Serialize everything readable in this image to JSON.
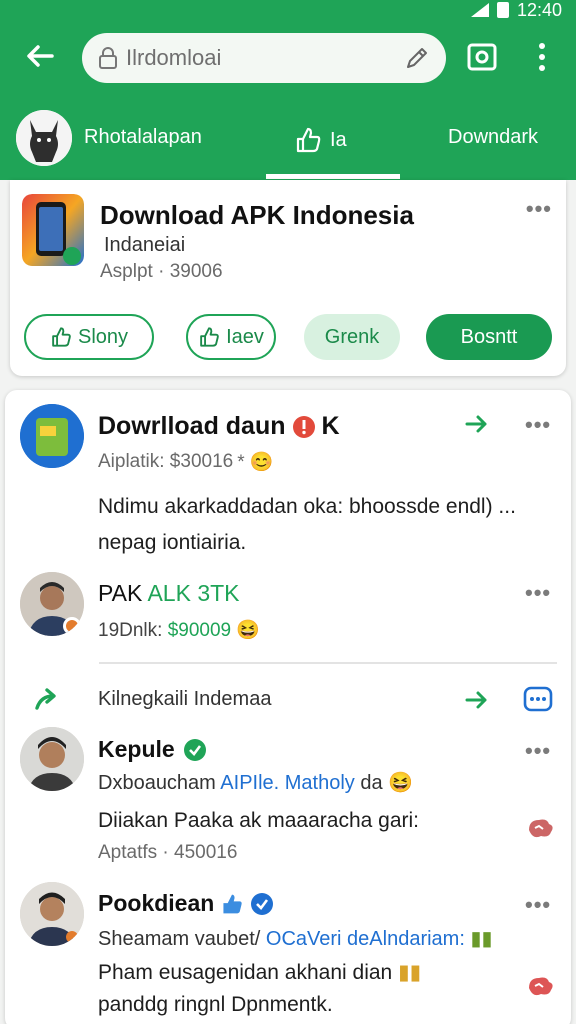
{
  "status": {
    "time": "12:40"
  },
  "search": {
    "value": "Ilrdomloai"
  },
  "tabs": [
    {
      "label": "Rhotalalapan"
    },
    {
      "label": "Ia"
    },
    {
      "label": "Downdark"
    }
  ],
  "card1": {
    "title": "Download APK Indonesia",
    "subtitle": "Indaneiai",
    "meta": "Asplpt · 39006",
    "buttons": {
      "b1": "Slony",
      "b2": "Iaev",
      "b3": "Grenk",
      "b4": "Bosntt"
    }
  },
  "post1": {
    "title": "Dowrlload daun",
    "title_suffix": "K",
    "meta": "Aiplatik: $30016",
    "body_line1": "Ndimu akarkaddadan oka: bhoossde endl) ...",
    "body_line2": "nepag iontiairia."
  },
  "post2": {
    "name_black": "PAK",
    "name_green": "ALK 3TK",
    "meta_black": "19Dnlk:",
    "meta_green": "$90009"
  },
  "share": {
    "label": "Kilnegkaili Indemaa"
  },
  "comment1": {
    "name": "Kepule",
    "line1_black": "Dxboaucham",
    "line1_blue": "AIPIle. Matholy",
    "line1_end": "da",
    "line2": "Diiakan Paaka ak maaaracha gari:",
    "meta": "Aptatfs · 450016"
  },
  "comment2": {
    "name": "Pookdiean",
    "line1_black": "Sheamam vaubet/",
    "line1_blue": "OCaVeri",
    "line1_end": "deAlndariam:",
    "line2": "Pham eusagenidan akhani dian",
    "line3": "panddg ringnl Dpnmentk."
  },
  "colors": {
    "brand_green": "#1fa457",
    "accent_blue": "#1f6fd1",
    "danger_red": "#e24a3b"
  }
}
